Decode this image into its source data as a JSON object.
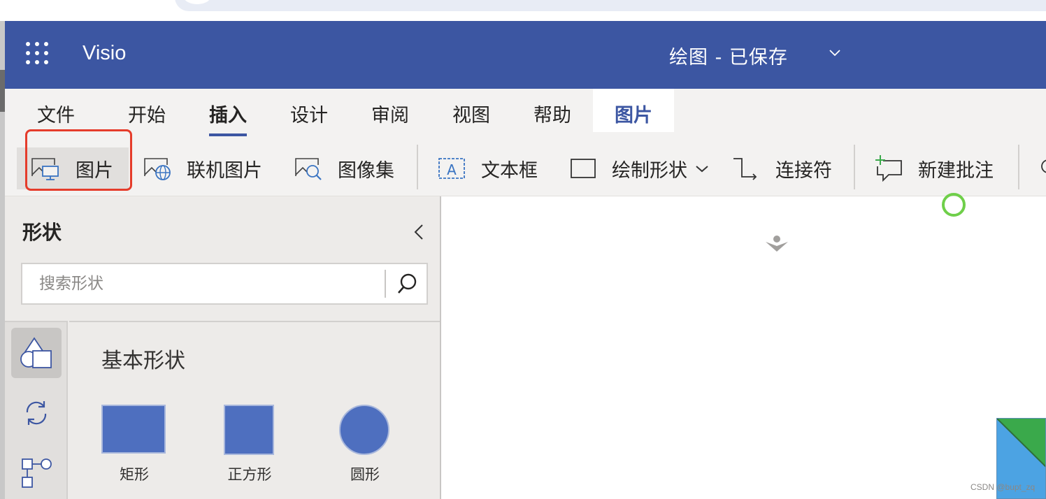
{
  "header": {
    "app_name": "Visio",
    "doc_title": "绘图 - 已保存",
    "brand_color": "#3c56a2"
  },
  "ribbon": {
    "tabs": [
      {
        "label": "文件"
      },
      {
        "label": "开始"
      },
      {
        "label": "插入",
        "active": true
      },
      {
        "label": "设计"
      },
      {
        "label": "审阅"
      },
      {
        "label": "视图"
      },
      {
        "label": "帮助"
      },
      {
        "label": "图片",
        "contextual": true
      }
    ],
    "commands": [
      {
        "label": "图片",
        "icon": "picture-icon",
        "highlighted": true
      },
      {
        "label": "联机图片",
        "icon": "online-picture-icon"
      },
      {
        "label": "图像集",
        "icon": "image-set-icon"
      },
      {
        "label": "文本框",
        "icon": "text-box-icon"
      },
      {
        "label": "绘制形状",
        "icon": "draw-shape-icon"
      },
      {
        "label": "连接符",
        "icon": "connector-icon"
      },
      {
        "label": "新建批注",
        "icon": "new-comment-icon"
      }
    ],
    "highlight_color": "#e53c2b"
  },
  "shapes_pane": {
    "title": "形状",
    "search_placeholder": "搜索形状",
    "stencil_title": "基本形状",
    "shapes": [
      {
        "label": "矩形",
        "icon": "rectangle-shape"
      },
      {
        "label": "正方形",
        "icon": "square-shape"
      },
      {
        "label": "圆形",
        "icon": "circle-shape"
      }
    ],
    "shape_color": "#4e6fbf"
  },
  "watermark": "CSDN @bupt_zq"
}
